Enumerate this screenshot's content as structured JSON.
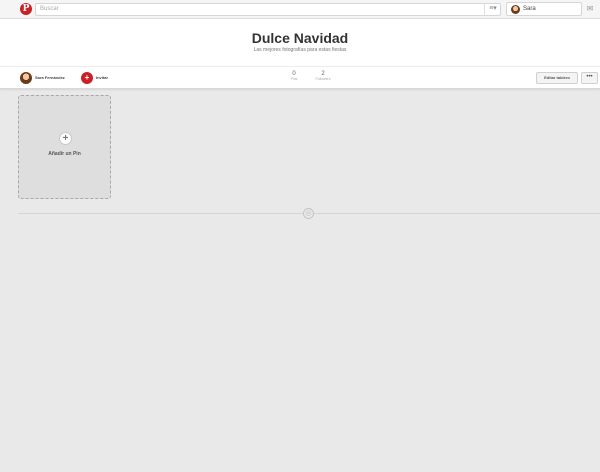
{
  "topbar": {
    "logo_glyph": "P",
    "search_placeholder": "Buscar",
    "menu_glyph": "≡▾",
    "user_name": "Sara",
    "notif_glyph": "✉"
  },
  "board": {
    "title": "Dulce Navidad",
    "description": "Las mejores fotografías para estas fiestas"
  },
  "infobar": {
    "owner_name": "Sara Fernández",
    "invite_glyph": "+",
    "invite_label": "Invitar",
    "stats": [
      {
        "value": "0",
        "label": "Pins"
      },
      {
        "value": "2",
        "label": "Followers"
      }
    ],
    "edit_label": "Editar tablero",
    "more_label": "•••"
  },
  "add_pin": {
    "plus_glyph": "+",
    "label": "Añadir un Pin"
  },
  "divider": {
    "glyph": "◎"
  },
  "colors": {
    "brand": "#cb2027",
    "background": "#e9e9e9"
  },
  "icons": [
    "pinterest-logo-icon",
    "menu-icon",
    "avatar-icon",
    "messages-icon",
    "invite-icon",
    "plus-icon",
    "loading-spinner-icon"
  ]
}
